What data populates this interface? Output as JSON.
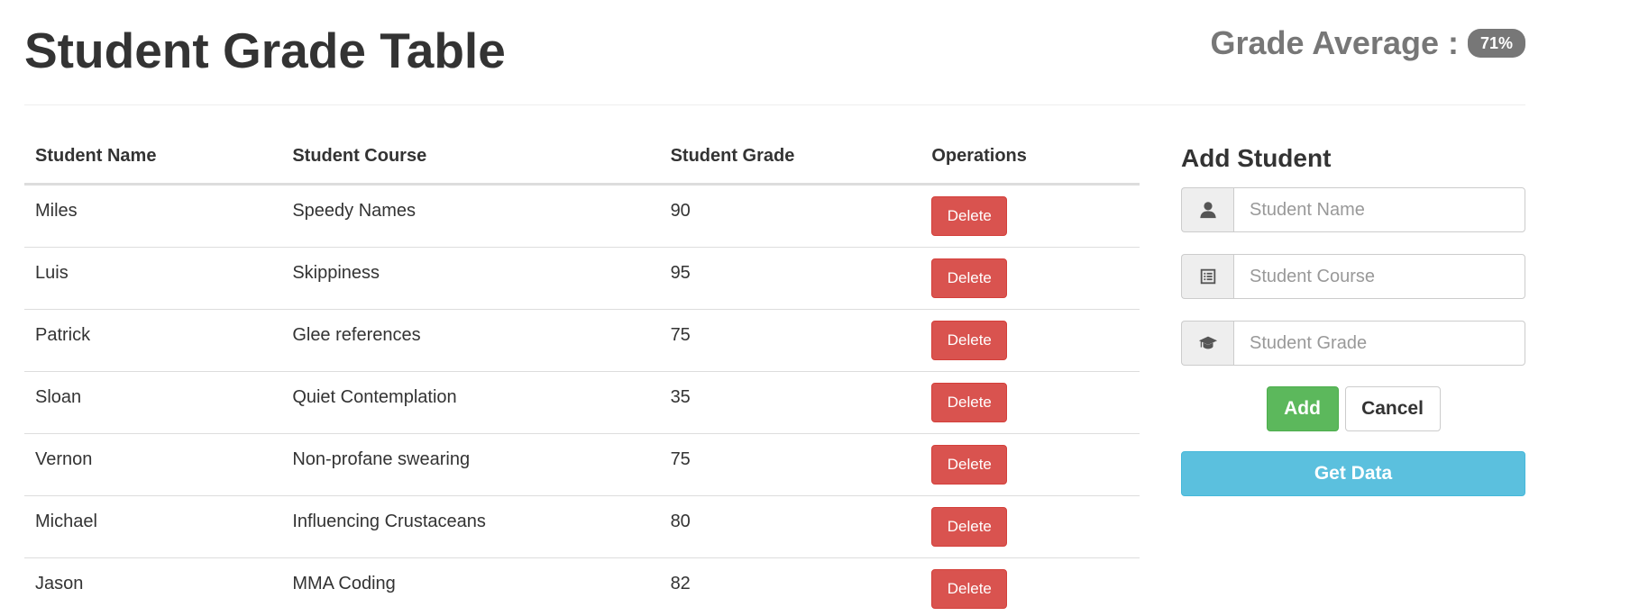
{
  "header": {
    "title": "Student Grade Table",
    "average_label": "Grade Average :",
    "average_value": "71%"
  },
  "table": {
    "columns": [
      "Student Name",
      "Student Course",
      "Student Grade",
      "Operations"
    ],
    "rows": [
      {
        "name": "Miles",
        "course": "Speedy Names",
        "grade": "90",
        "action": "Delete"
      },
      {
        "name": "Luis",
        "course": "Skippiness",
        "grade": "95",
        "action": "Delete"
      },
      {
        "name": "Patrick",
        "course": "Glee references",
        "grade": "75",
        "action": "Delete"
      },
      {
        "name": "Sloan",
        "course": "Quiet Contemplation",
        "grade": "35",
        "action": "Delete"
      },
      {
        "name": "Vernon",
        "course": "Non-profane swearing",
        "grade": "75",
        "action": "Delete"
      },
      {
        "name": "Michael",
        "course": "Influencing Crustaceans",
        "grade": "80",
        "action": "Delete"
      },
      {
        "name": "Jason",
        "course": "MMA Coding",
        "grade": "82",
        "action": "Delete"
      }
    ]
  },
  "form": {
    "title": "Add Student",
    "name_field": {
      "placeholder": "Student Name",
      "value": "",
      "icon": "user-icon"
    },
    "course_field": {
      "placeholder": "Student Course",
      "value": "",
      "icon": "list-alt-icon"
    },
    "grade_field": {
      "placeholder": "Student Grade",
      "value": "",
      "icon": "graduation-cap-icon"
    },
    "add_label": "Add",
    "cancel_label": "Cancel",
    "get_data_label": "Get Data"
  },
  "colors": {
    "danger": "#d9534f",
    "success": "#5cb85c",
    "info": "#5bc0de",
    "badge": "#777777"
  }
}
